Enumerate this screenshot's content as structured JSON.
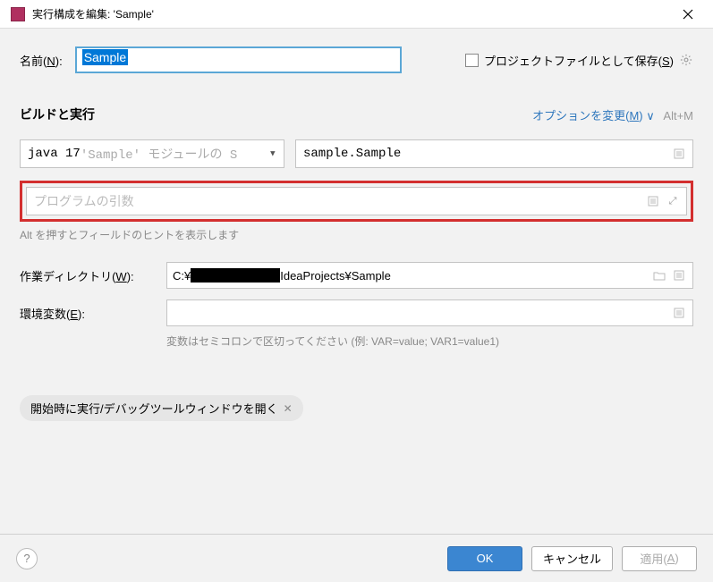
{
  "titlebar": {
    "title": "実行構成を編集: 'Sample'"
  },
  "name": {
    "label_prefix": "名前(",
    "label_mnemonic": "N",
    "label_suffix": "):",
    "value": "Sample"
  },
  "store": {
    "label_prefix": "プロジェクトファイルとして保存(",
    "label_mnemonic": "S",
    "label_suffix": ")"
  },
  "section": {
    "title": "ビルドと実行",
    "modify_prefix": "オプションを変更(",
    "modify_mnemonic": "M",
    "modify_suffix": ")",
    "shortcut": "Alt+M"
  },
  "jdk": {
    "prefix": "java 17",
    "suffix": " 'Sample' モジュールの S"
  },
  "main_class": {
    "value": "sample.Sample"
  },
  "args": {
    "placeholder": "プログラムの引数"
  },
  "hint": "Alt を押すとフィールドのヒントを表示します",
  "workdir": {
    "label_prefix": "作業ディレクトリ(",
    "label_mnemonic": "W",
    "label_suffix": "):",
    "value_prefix": "C:¥",
    "value_suffix": "IdeaProjects¥Sample"
  },
  "env": {
    "label_prefix": "環境変数(",
    "label_mnemonic": "E",
    "label_suffix": "):",
    "hint": "変数はセミコロンで区切ってください (例: VAR=value; VAR1=value1)"
  },
  "chip": {
    "label": "開始時に実行/デバッグツールウィンドウを開く"
  },
  "footer": {
    "ok": "OK",
    "cancel": "キャンセル",
    "apply_prefix": "適用(",
    "apply_mnemonic": "A",
    "apply_suffix": ")"
  }
}
